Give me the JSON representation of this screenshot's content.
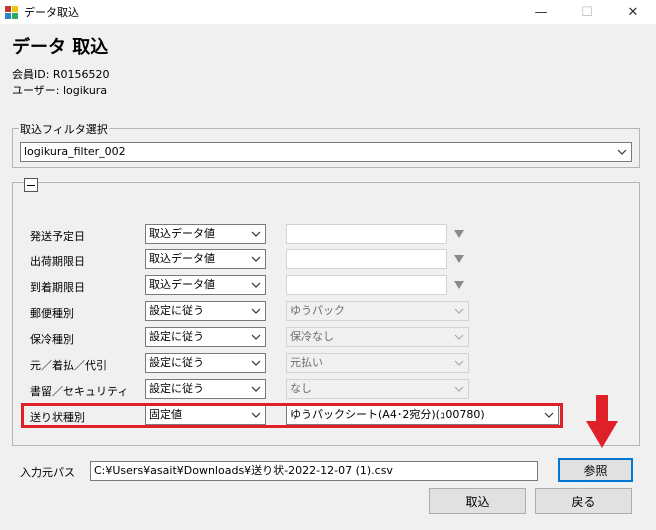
{
  "window": {
    "title": "データ取込",
    "minimize": "—",
    "maximize": "☐",
    "close": "✕"
  },
  "header": {
    "title": "データ 取込",
    "member_id": "会員ID: R0156520",
    "user": "ユーザー: logikura"
  },
  "filter": {
    "label": "取込フィルタ選択",
    "selected": "logikura_filter_002"
  },
  "settings": {
    "collapse_icon": "minus-box-icon",
    "rows": [
      {
        "label": "発送予定日",
        "mode": "取込データ値",
        "value": ""
      },
      {
        "label": "出荷期限日",
        "mode": "取込データ値",
        "value": ""
      },
      {
        "label": "到着期限日",
        "mode": "取込データ値",
        "value": ""
      },
      {
        "label": "郵便種別",
        "mode": "設定に従う",
        "value": "ゆうパック"
      },
      {
        "label": "保冷種別",
        "mode": "設定に従う",
        "value": "保冷なし"
      },
      {
        "label": "元／着払／代引",
        "mode": "設定に従う",
        "value": "元払い"
      },
      {
        "label": "書留／セキュリティ",
        "mode": "設定に従う",
        "value": "なし"
      },
      {
        "label": "送り状種別",
        "mode": "固定値",
        "value": "ゆうパックシート(A4･2宛分)(ｭ00780)"
      }
    ]
  },
  "input_path": {
    "label": "入力元パス",
    "value": "C:¥Users¥asait¥Downloads¥送り状-2022-12-07 (1).csv",
    "browse_label": "参照"
  },
  "buttons": {
    "import": "取込",
    "back": "戻る"
  },
  "colors": {
    "highlight": "#e02028",
    "arrow": "#e02028"
  }
}
